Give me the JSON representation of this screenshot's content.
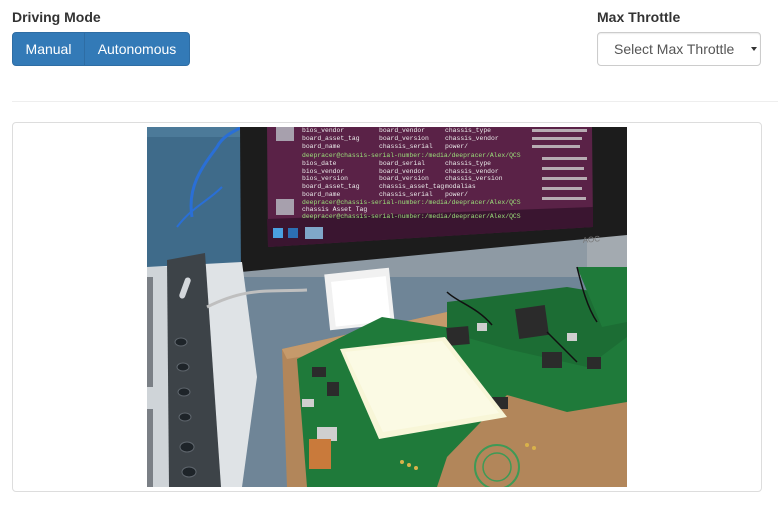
{
  "driving_mode": {
    "label": "Driving Mode",
    "options": [
      "Manual",
      "Autonomous"
    ]
  },
  "max_throttle": {
    "label": "Max Throttle",
    "placeholder": "Select Max Throttle"
  },
  "camera_feed": {
    "terminal": {
      "col1": [
        "bios_vendor",
        "board_asset_tag",
        "board_name",
        "bios_date",
        "bios_vendor",
        "bios_version",
        "board_asset_tag",
        "board_name"
      ],
      "col2": [
        "board_vendor",
        "board_version",
        "chassis_serial",
        "board_serial",
        "board_vendor",
        "board_version",
        "chassis_asset_tag",
        "chassis_serial"
      ],
      "col3": [
        "chassis_type",
        "chassis_vendor",
        "power/",
        "chassis_type",
        "chassis_vendor",
        "chassis_version",
        "modalias",
        "power/"
      ],
      "prompt": "deepracer@chassis-serial-number:/media/deepracer/Alex/QCS",
      "asset_line": "chassis Asset Tag",
      "monitor_brand": "AOC"
    },
    "colors": {
      "wall": "#6f8597",
      "desk": "#b2865a",
      "pcb": "#1f7a3a",
      "screen": "#5a2247"
    }
  }
}
